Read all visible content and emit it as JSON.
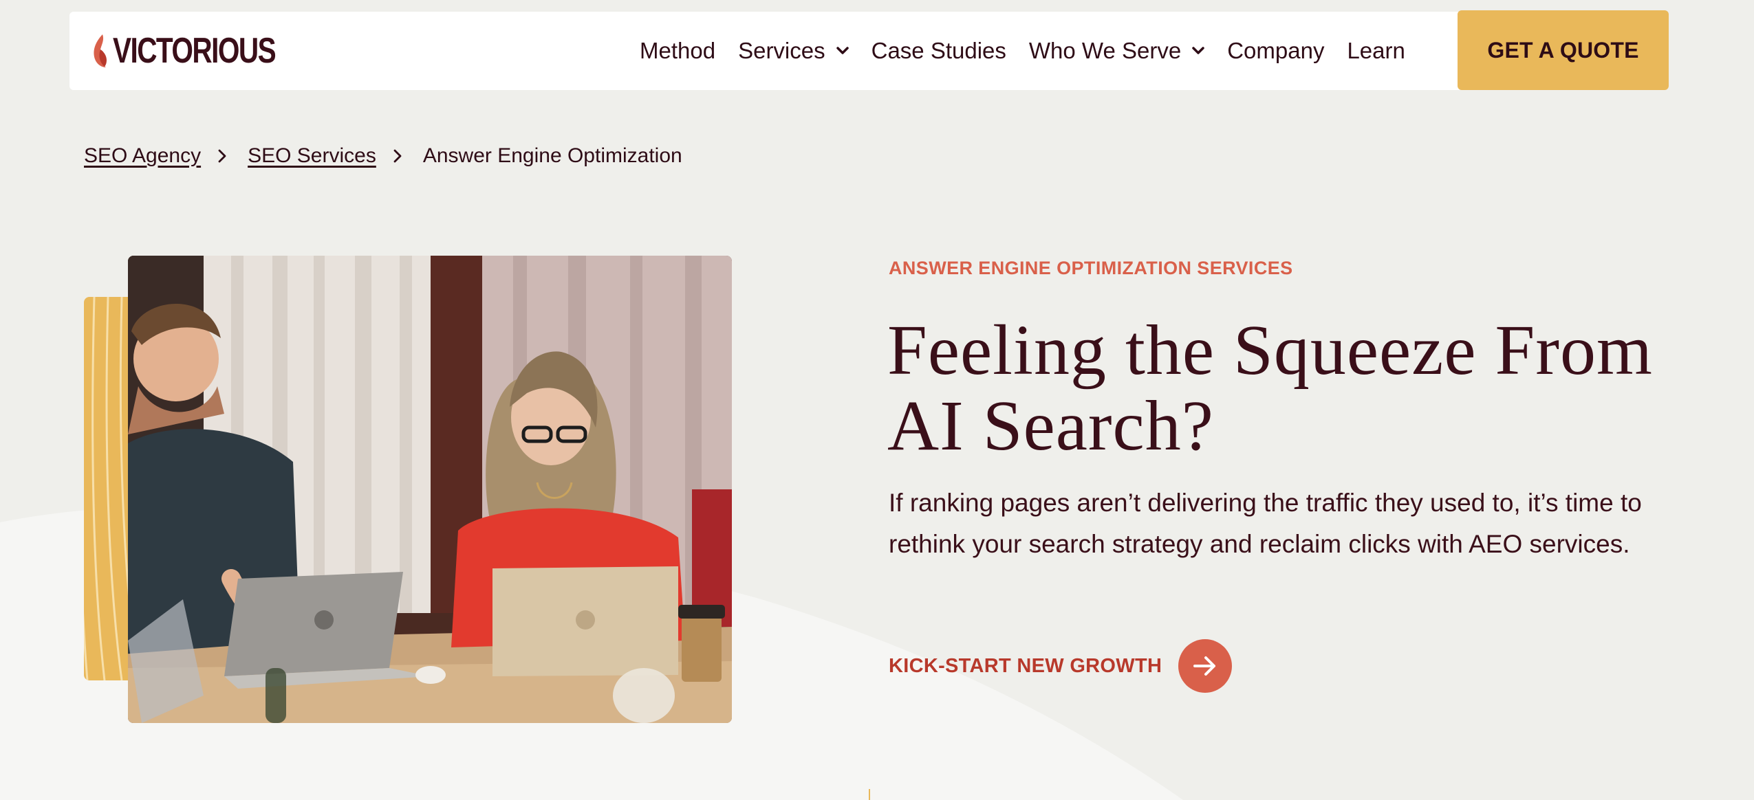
{
  "nav": {
    "logo_text": "VICTORIOUS",
    "items": [
      {
        "label": "Method",
        "has_dropdown": false
      },
      {
        "label": "Services",
        "has_dropdown": true
      },
      {
        "label": "Case Studies",
        "has_dropdown": false
      },
      {
        "label": "Who We Serve",
        "has_dropdown": true
      },
      {
        "label": "Company",
        "has_dropdown": false
      },
      {
        "label": "Learn",
        "has_dropdown": false
      }
    ],
    "cta_label": "GET A QUOTE"
  },
  "breadcrumb": {
    "items": [
      {
        "label": "SEO Agency",
        "link": true
      },
      {
        "label": "SEO Services",
        "link": true
      },
      {
        "label": "Answer Engine Optimization",
        "link": false
      }
    ]
  },
  "hero": {
    "eyebrow": "ANSWER ENGINE OPTIMIZATION SERVICES",
    "headline": "Feeling the Squeeze From AI Search?",
    "body": "If ranking pages aren’t delivering the traffic they used to, it’s time to rethink your search strategy and reclaim clicks with AEO services.",
    "cta_label": "KICK-START NEW GROWTH"
  },
  "colors": {
    "page_bg": "#efefeb",
    "accent_gold": "#e9b85a",
    "accent_coral": "#d9604a",
    "cta_text": "#b8392b",
    "text_dark": "#3a0f19"
  },
  "icons": {
    "logo": "flame-icon",
    "dropdown": "chevron-down-icon",
    "breadcrumb_sep": "chevron-right-icon",
    "cta": "arrow-right-icon"
  }
}
